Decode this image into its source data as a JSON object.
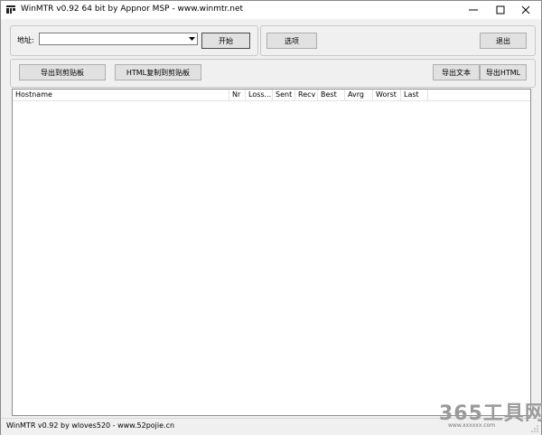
{
  "titlebar": {
    "title": "WinMTR v0.92 64 bit by Appnor MSP - www.winmtr.net",
    "minimize_icon": "minimize-icon",
    "maximize_icon": "maximize-icon",
    "close_icon": "close-icon"
  },
  "host_group": {
    "address_label": "地址:",
    "address_value": "",
    "start_label": "开始"
  },
  "options_group": {
    "options_label": "选项",
    "exit_label": "退出"
  },
  "export_group": {
    "copy_text_label": "导出到剪贴板",
    "copy_html_label": "HTML复制到剪贴板",
    "export_text_label": "导出文本",
    "export_html_label": "导出HTML"
  },
  "table": {
    "columns": [
      "Hostname",
      "Nr",
      "Loss...",
      "Sent",
      "Recv",
      "Best",
      "Avrg",
      "Worst",
      "Last"
    ],
    "rows": []
  },
  "statusbar": {
    "text": "WinMTR v0.92 by wloves520 - www.52pojie.cn"
  },
  "watermark": {
    "text": "365工具网",
    "sub": "www.xxxxxx.com"
  },
  "colors": {
    "window_bg": "#f0f0f0",
    "button_bg": "#e1e1e1",
    "border": "#adadad"
  }
}
